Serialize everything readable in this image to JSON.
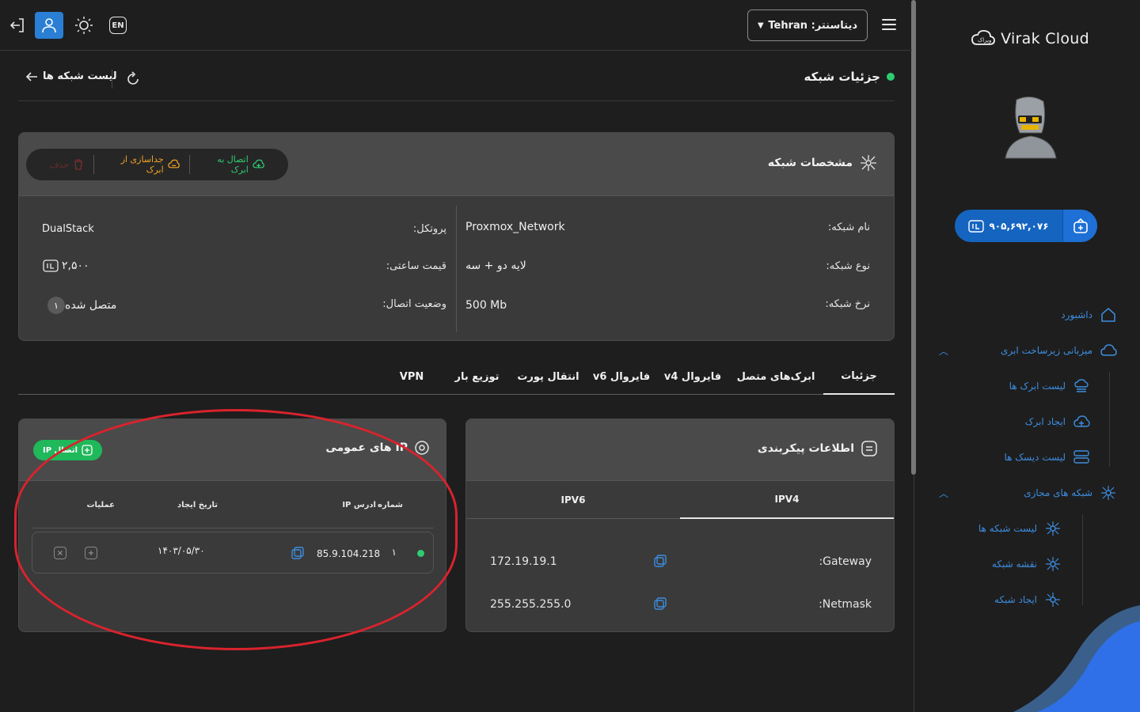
{
  "sidebar": {
    "brand": "Virak Cloud",
    "wallet_balance": "۹۰۵,۶۹۲,۰۷۶",
    "items": [
      {
        "label": "داشبورد"
      },
      {
        "label": "میزبانی زیرساخت ابری"
      },
      {
        "label": "لیست ابرک ها"
      },
      {
        "label": "ایجاد ابرک"
      },
      {
        "label": "لیست دیسک ها"
      },
      {
        "label": "شبکه های مجازی"
      },
      {
        "label": "لیست شبکه ها"
      },
      {
        "label": "نقشه شبکه"
      },
      {
        "label": "ایجاد شبکه"
      }
    ]
  },
  "topbar": {
    "lang": "EN",
    "datacenter_label": "دیتاسنتر: Tehran"
  },
  "header": {
    "title": "جزئیات شبکه",
    "back_label": "لیست شبکه ها"
  },
  "spec": {
    "title": "مشخصات شبکه",
    "connect_label": "اتصال به ابرک",
    "disconnect_label": "جداسازی از ابرک",
    "delete_label": "حذف",
    "fields": {
      "name_label": "نام شبکه:",
      "name_value": "Proxmox_Network",
      "type_label": "نوع شبکه:",
      "type_value": "لایه دو + سه",
      "rate_label": "نرخ شبکه:",
      "rate_value": "500 Mb",
      "protocol_label": "پروتکل:",
      "protocol_value": "DualStack",
      "price_label": "قیمت ساعتی:",
      "price_value": "۲,۵۰۰",
      "status_label": "وضعیت اتصال:",
      "status_value": "متصل شده",
      "status_count": "۱"
    }
  },
  "tabs": [
    "جزئیات",
    "ابرک‌های متصل",
    "فایروال v4",
    "فایروال v6",
    "انتقال پورت",
    "توزیع بار",
    "VPN"
  ],
  "config": {
    "title": "اطلاعات پیکربندی",
    "tab_ipv4": "IPV4",
    "tab_ipv6": "IPV6",
    "gateway_label": ":Gateway",
    "gateway_value": "172.19.19.1",
    "netmask_label": ":Netmask",
    "netmask_value": "255.255.255.0"
  },
  "public_ip": {
    "title": "IP های عمومی",
    "connect_label": "اتصال IP",
    "columns": {
      "num": "شماره",
      "ip": "ادرس IP",
      "date": "تاریخ ایجاد",
      "ops": "عملیات"
    },
    "rows": [
      {
        "num": "۱",
        "ip": "85.9.104.218",
        "date": "۱۴۰۳/۰۵/۳۰"
      }
    ]
  }
}
